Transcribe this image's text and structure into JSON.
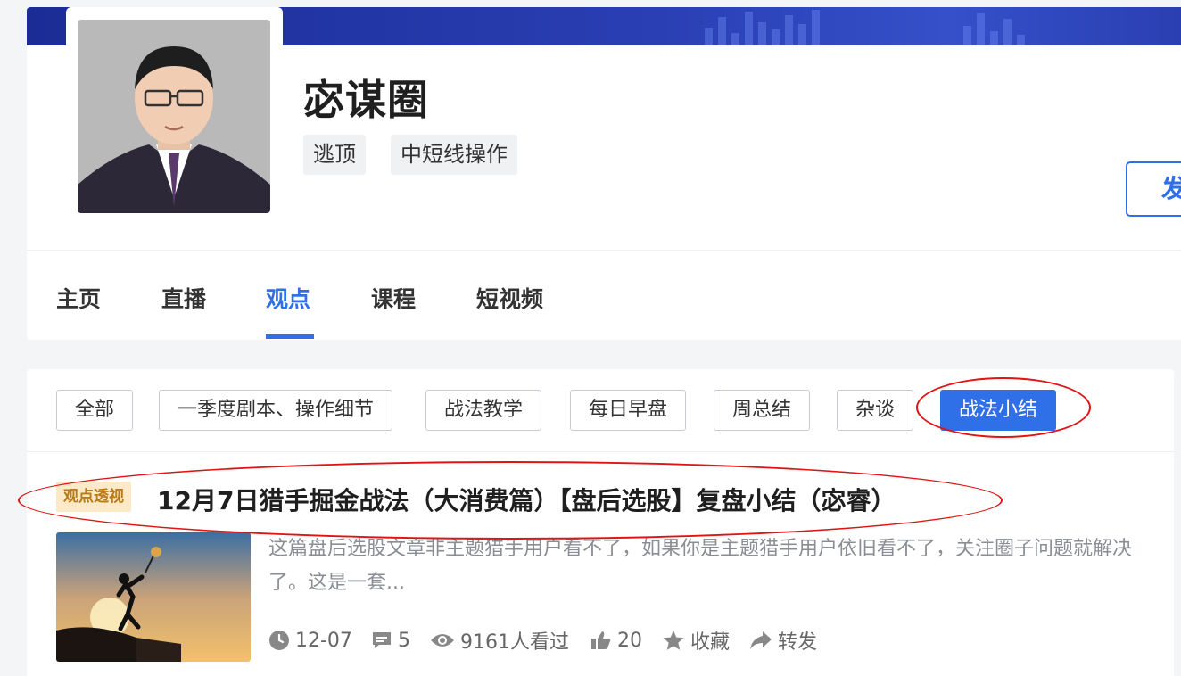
{
  "profile": {
    "name": "宓谋圈",
    "tags": [
      "逃顶",
      "中短线操作"
    ],
    "follow_label": "发"
  },
  "nav": {
    "tabs": [
      "主页",
      "直播",
      "观点",
      "课程",
      "短视频"
    ],
    "active_tab": "观点"
  },
  "filters": {
    "items": [
      "全部",
      "一季度剧本、操作细节",
      "战法教学",
      "每日早盘",
      "周总结",
      "杂谈",
      "战法小结"
    ],
    "active": "战法小结"
  },
  "article": {
    "badge": "观点透视",
    "title": "12月7日猎手掘金战法（大消费篇）【盘后选股】复盘小结（宓睿）",
    "summary": "这篇盘后选股文章非主题猎手用户看不了，如果你是主题猎手用户依旧看不了，关注圈子问题就解决了。这是一套...",
    "date": "12-07",
    "comments": "5",
    "views": "9161人看过",
    "likes": "20",
    "favorite_label": "收藏",
    "share_label": "转发"
  },
  "colors": {
    "accent": "#2f6fe8",
    "badge_bg": "#fbe9c8",
    "badge_text": "#b97a17",
    "annotation": "#e01414"
  },
  "icons": [
    "clock-icon",
    "comment-icon",
    "eye-icon",
    "thumbs-up-icon",
    "star-icon",
    "share-icon"
  ]
}
